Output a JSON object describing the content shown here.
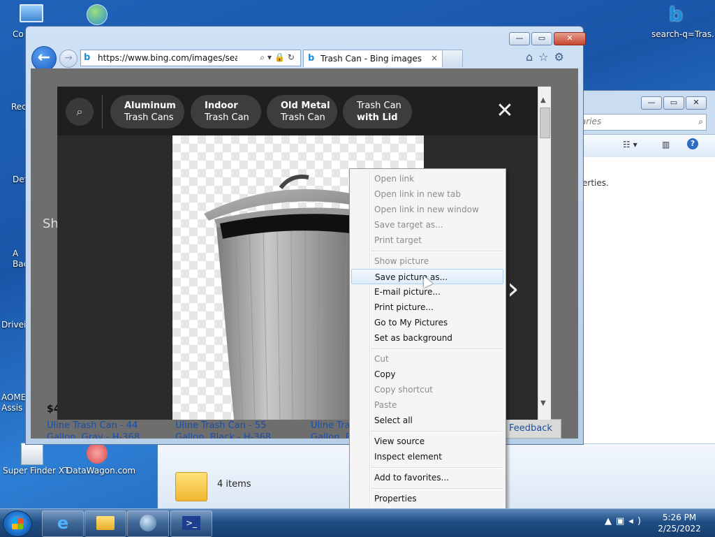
{
  "desktop": {
    "icons": [
      {
        "label": "Co"
      },
      {
        "label": "Rec"
      },
      {
        "label": "Def"
      },
      {
        "label": "A Bac"
      },
      {
        "label": "Drivei"
      },
      {
        "label": "AOME Assis"
      },
      {
        "label": "Super Finder XT"
      },
      {
        "label": "DataWagon.com"
      },
      {
        "label": "search-q=Tras..."
      }
    ]
  },
  "explorer": {
    "search_placeholder": "raries",
    "content_text": "erties.",
    "status_items": "4 items"
  },
  "ie": {
    "url": "https://www.bing.com/images/search?vi",
    "tab_title": "Trash Can - Bing images",
    "tab_close": "×",
    "page_behind": {
      "left_heading": "Sh",
      "price": "$4",
      "results": [
        {
          "line1": "Uline Trash Can - 44",
          "line2": "Gallon, Gray - H-368"
        },
        {
          "line1": "Uline Trash Can - 55",
          "line2": "Gallon, Black - H-368"
        },
        {
          "line1": "Uline Tras",
          "line2": "Gallon, Bl"
        }
      ],
      "feedback": "Feedback"
    }
  },
  "overlay": {
    "chips": [
      {
        "l1": "Aluminum",
        "l2": "Trash Cans",
        "bold": "l1"
      },
      {
        "l1": "Indoor",
        "l2": "Trash Can",
        "bold": "l1"
      },
      {
        "l1": "Old Metal",
        "l2": "Trash Can",
        "bold": "l1"
      },
      {
        "l1": "Trash Can",
        "l2": "with Lid",
        "bold": "l2"
      }
    ],
    "close": "✕",
    "next": "›"
  },
  "context_menu": {
    "items": [
      {
        "label": "Open link",
        "disabled": true
      },
      {
        "label": "Open link in new tab",
        "disabled": true
      },
      {
        "label": "Open link in new window",
        "disabled": true
      },
      {
        "label": "Save target as...",
        "disabled": true
      },
      {
        "label": "Print target",
        "disabled": true
      },
      {
        "label": "Show picture",
        "disabled": true
      },
      {
        "label": "Save picture as...",
        "disabled": false,
        "highlighted": true
      },
      {
        "label": "E-mail picture...",
        "disabled": false
      },
      {
        "label": "Print picture...",
        "disabled": false
      },
      {
        "label": "Go to My Pictures",
        "disabled": false
      },
      {
        "label": "Set as background",
        "disabled": false
      },
      {
        "label": "Cut",
        "disabled": true
      },
      {
        "label": "Copy",
        "disabled": false
      },
      {
        "label": "Copy shortcut",
        "disabled": true
      },
      {
        "label": "Paste",
        "disabled": true
      },
      {
        "label": "Select all",
        "disabled": false
      },
      {
        "label": "View source",
        "disabled": false
      },
      {
        "label": "Inspect element",
        "disabled": false
      },
      {
        "label": "Add to favorites...",
        "disabled": false
      },
      {
        "label": "Properties",
        "disabled": false
      }
    ]
  },
  "taskbar": {
    "time": "5:26 PM",
    "date": "2/25/2022"
  },
  "colors": {
    "desktop_blue": "#1f63b8",
    "menu_highlight": "#dfeefc",
    "overlay_dark": "#2b2b2b"
  }
}
